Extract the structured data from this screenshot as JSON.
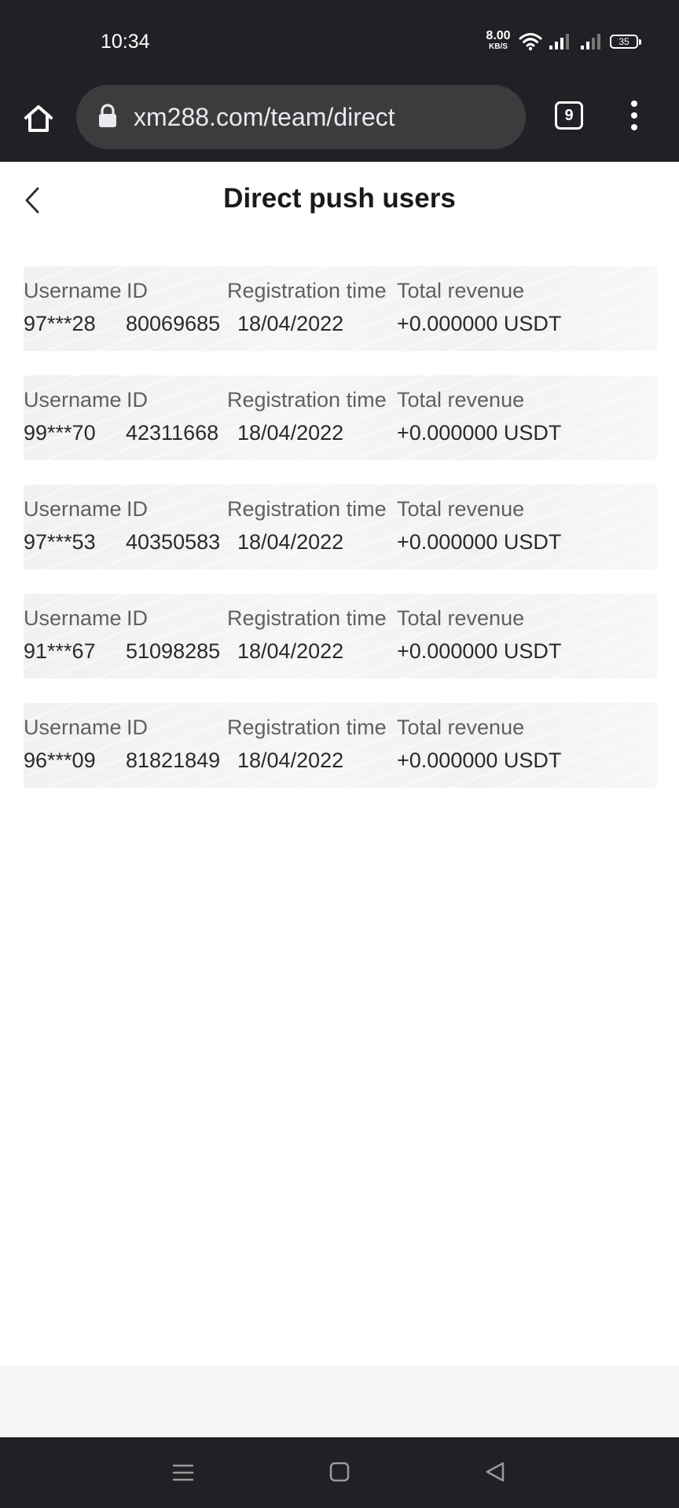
{
  "status_bar": {
    "time": "10:34",
    "net_speed": "8.00",
    "net_speed_unit": "KB/S",
    "battery_level": "35"
  },
  "browser": {
    "url": "xm288.com/team/direct",
    "tab_count": "9"
  },
  "page": {
    "title": "Direct push users"
  },
  "columns": {
    "username": "Username",
    "id": "ID",
    "registration_time": "Registration time",
    "total_revenue": "Total revenue"
  },
  "users": [
    {
      "username": "97***28",
      "id": "80069685",
      "registration_time": "18/04/2022",
      "total_revenue": "+0.000000 USDT"
    },
    {
      "username": "99***70",
      "id": "42311668",
      "registration_time": "18/04/2022",
      "total_revenue": "+0.000000 USDT"
    },
    {
      "username": "97***53",
      "id": "40350583",
      "registration_time": "18/04/2022",
      "total_revenue": "+0.000000 USDT"
    },
    {
      "username": "91***67",
      "id": "51098285",
      "registration_time": "18/04/2022",
      "total_revenue": "+0.000000 USDT"
    },
    {
      "username": "96***09",
      "id": "81821849",
      "registration_time": "18/04/2022",
      "total_revenue": "+0.000000 USDT"
    }
  ]
}
